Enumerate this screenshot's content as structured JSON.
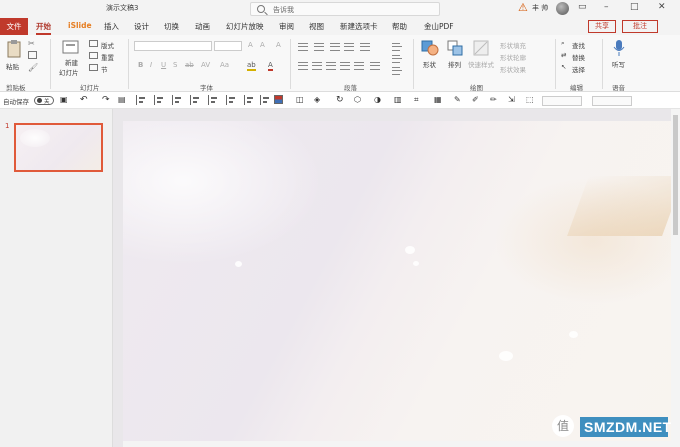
{
  "window": {
    "title": "演示文稿3",
    "search_hint": "告诉我",
    "user": "丰 帅"
  },
  "tabs": [
    "文件",
    "开始",
    "iSlide",
    "插入",
    "设计",
    "切换",
    "动画",
    "幻灯片放映",
    "审阅",
    "视图",
    "新建选项卡",
    "帮助",
    "金山PDF"
  ],
  "actions": {
    "share": "共享",
    "comment": "批注"
  },
  "ribbon": {
    "clipboard": {
      "paste": "粘贴",
      "label": "剪贴板"
    },
    "slides": {
      "new_slide": "新建",
      "new_slide2": "幻灯片",
      "layout": "版式",
      "reset": "重置",
      "section": "节",
      "label": "幻灯片"
    },
    "font": {
      "label": "字体"
    },
    "paragraph": {
      "label": "段落"
    },
    "drawing": {
      "shapes": "形状",
      "arrange": "排列",
      "quick_styles": "快速样式",
      "fill": "形状填充",
      "outline": "形状轮廓",
      "effects": "形状效果",
      "label": "绘图"
    },
    "editing": {
      "find": "查找",
      "replace": "替换",
      "select": "选择",
      "label": "编辑"
    },
    "voice": {
      "dictate": "听写",
      "label": "语音"
    }
  },
  "quick_toolbar": {
    "autosave_label": "自动保存",
    "autosave_state": "关"
  },
  "slides_pane": {
    "slide_number": "1"
  },
  "watermark": {
    "glyph": "值",
    "text": "SMZDM.NET"
  },
  "colors": {
    "accent": "#c0392b",
    "islide": "#e67e22",
    "watermark_bg": "#3f8fbf"
  }
}
